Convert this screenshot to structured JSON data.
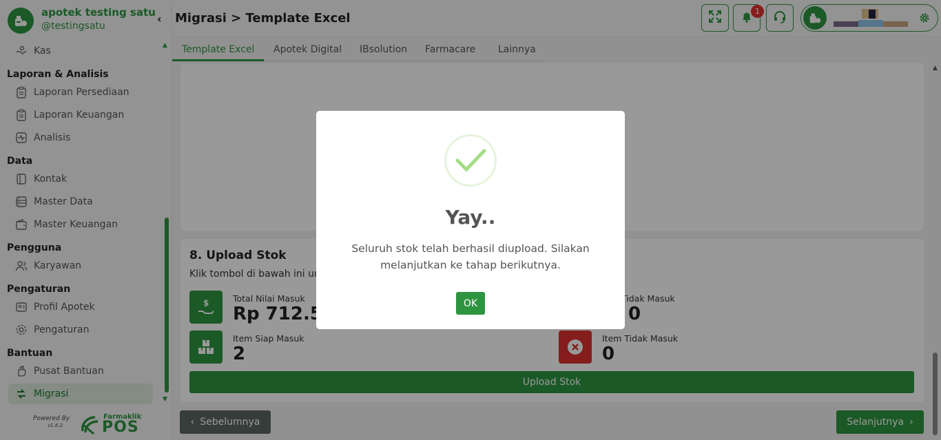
{
  "brand": {
    "name": "apotek testing satu",
    "handle": "@testingsatu"
  },
  "header": {
    "title": "Migrasi > Template Excel",
    "notif_count": "1"
  },
  "sidebar": {
    "items": [
      {
        "label": "Kas"
      },
      {
        "section": "Laporan & Analisis"
      },
      {
        "label": "Laporan Persediaan"
      },
      {
        "label": "Laporan Keuangan"
      },
      {
        "label": "Analisis"
      },
      {
        "section": "Data"
      },
      {
        "label": "Kontak"
      },
      {
        "label": "Master Data"
      },
      {
        "label": "Master Keuangan"
      },
      {
        "section": "Pengguna"
      },
      {
        "label": "Karyawan"
      },
      {
        "section": "Pengaturan"
      },
      {
        "label": "Profil Apotek"
      },
      {
        "label": "Pengaturan"
      },
      {
        "section": "Bantuan"
      },
      {
        "label": "Pusat Bantuan"
      },
      {
        "label": "Migrasi"
      }
    ],
    "footer": {
      "powered": "Powered By",
      "version": "v1.6.2",
      "logo_small": "Farmaklik",
      "logo_big": "POS"
    }
  },
  "tabs": [
    "Template Excel",
    "Apotek Digital",
    "IBsolution",
    "Farmacare",
    "Lainnya"
  ],
  "upload": {
    "title": "8. Upload Stok",
    "desc": "Klik tombol di bawah ini un",
    "total_nilai_label": "Total Nilai Masuk",
    "total_nilai_value": "Rp 712.50",
    "nilai_tidak_label": "Tidak Masuk",
    "nilai_tidak_value": "0",
    "item_siap_label": "Item Siap Masuk",
    "item_siap_value": "2",
    "item_tidak_label": "Item Tidak Masuk",
    "item_tidak_value": "0",
    "button": "Upload Stok"
  },
  "nav": {
    "prev": "Sebelumnya",
    "next": "Selanjutnya"
  },
  "modal": {
    "title": "Yay..",
    "text": "Seluruh stok telah berhasil diupload. Silakan melanjutkan ke tahap berikutnya.",
    "ok": "OK"
  },
  "colors": {
    "primary": "#2e9440",
    "danger": "#e03131",
    "secondary": "#5a6661"
  }
}
